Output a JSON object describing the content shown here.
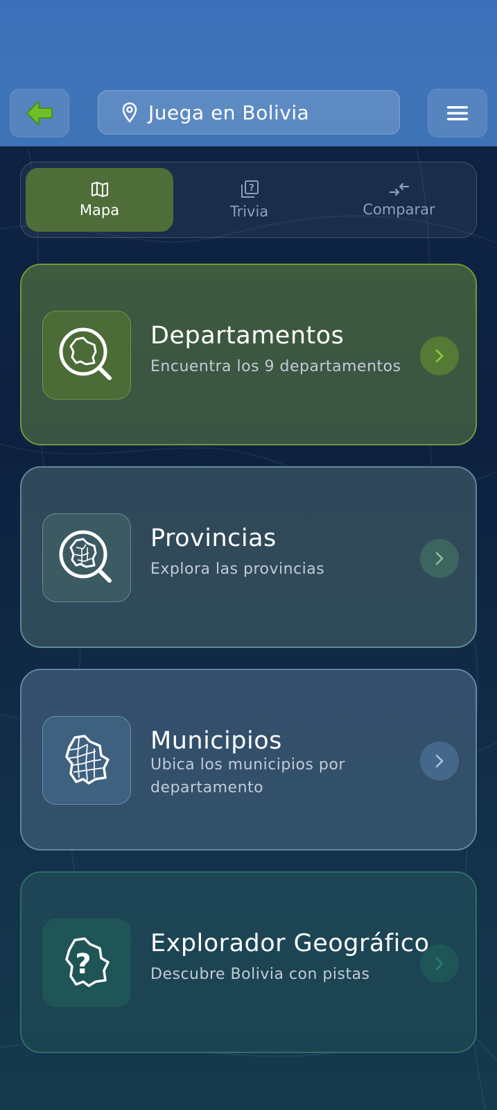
{
  "header": {
    "title": "Juega en Bolivia",
    "back_icon": "arrow-left-icon",
    "location_icon": "location-pin-icon",
    "menu_icon": "hamburger-menu-icon"
  },
  "tabs": [
    {
      "label": "Mapa",
      "icon": "map-icon",
      "active": true
    },
    {
      "label": "Trivia",
      "icon": "question-cards-icon",
      "active": false
    },
    {
      "label": "Comparar",
      "icon": "compare-arrows-icon",
      "active": false
    }
  ],
  "cards": [
    {
      "title": "Departamentos",
      "subtitle": "Encuentra los 9 departamentos",
      "icon": "bolivia-search-icon"
    },
    {
      "title": "Provincias",
      "subtitle": "Explora las provincias",
      "icon": "bolivia-provinces-search-icon"
    },
    {
      "title": "Municipios",
      "subtitle": "Ubica los municipios por departamento",
      "icon": "bolivia-municipalities-icon"
    },
    {
      "title": "Explorador Geográfico",
      "subtitle": "Descubre Bolivia con pistas",
      "icon": "bolivia-question-icon"
    }
  ],
  "colors": {
    "accent_green": "#6fbf2a",
    "header_blue": "#3f74b8",
    "background": "#0f2344"
  }
}
